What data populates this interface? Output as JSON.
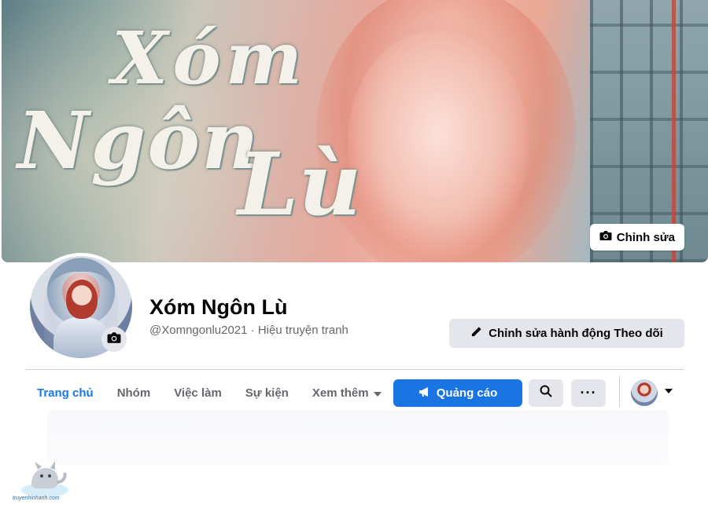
{
  "cover": {
    "title_art": [
      "Xóm",
      "Ngôn",
      "Lù"
    ],
    "edit_button_label": "Chỉnh sửa"
  },
  "profile": {
    "name": "Xóm Ngôn Lù",
    "handle": "@Xomngonlu2021",
    "separator": " · ",
    "category": "Hiệu truyện tranh",
    "edit_action_label": "Chỉnh sửa hành động Theo dõi"
  },
  "tabs": [
    {
      "label": "Trang chủ",
      "active": true
    },
    {
      "label": "Nhóm",
      "active": false
    },
    {
      "label": "Việc làm",
      "active": false
    },
    {
      "label": "Sự kiện",
      "active": false
    },
    {
      "label": "Xem thêm",
      "active": false
    }
  ],
  "actions": {
    "ad_label": "Quảng cáo",
    "more_label": "···"
  },
  "watermark": {
    "text": "truyenhinhanh.com"
  },
  "colors": {
    "accent": "#1877f2",
    "button_gray": "#e4e6eb",
    "muted_text": "#65676b"
  }
}
